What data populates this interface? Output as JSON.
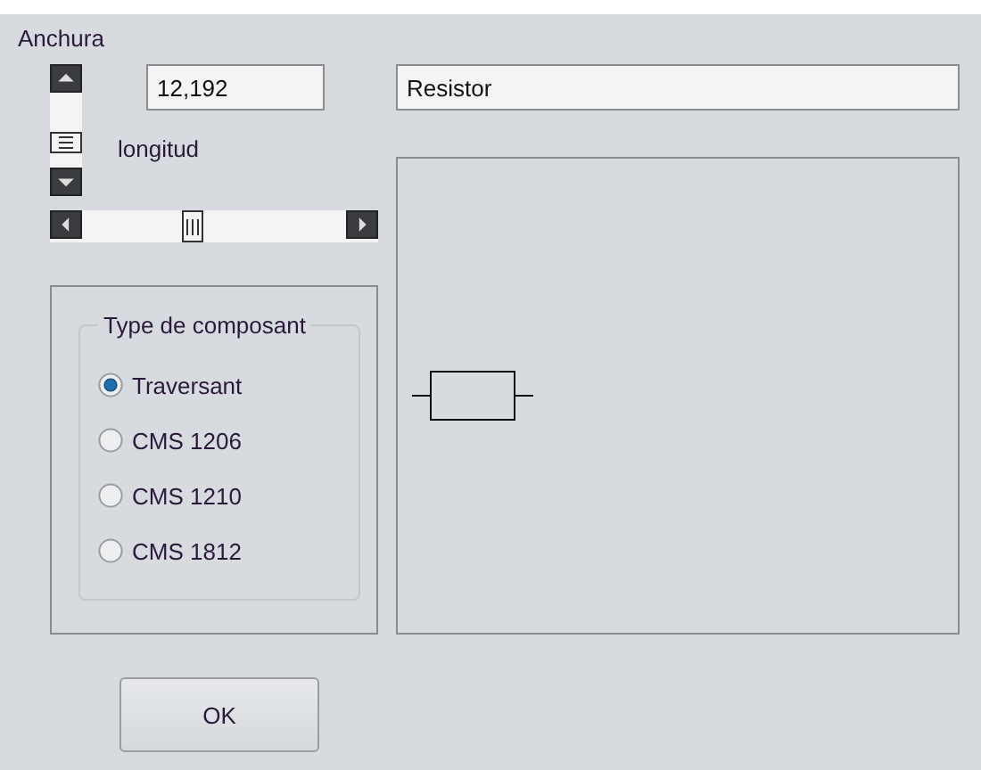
{
  "width_label": "Anchura",
  "width_value": "12,192",
  "length_label": "longitud",
  "name_value": "Resistor",
  "component_type": {
    "title": "Type de composant",
    "options": [
      {
        "label": "Traversant",
        "selected": true
      },
      {
        "label": "CMS 1206",
        "selected": false
      },
      {
        "label": "CMS 1210",
        "selected": false
      },
      {
        "label": "CMS 1812",
        "selected": false
      }
    ]
  },
  "buttons": [
    "OK"
  ]
}
